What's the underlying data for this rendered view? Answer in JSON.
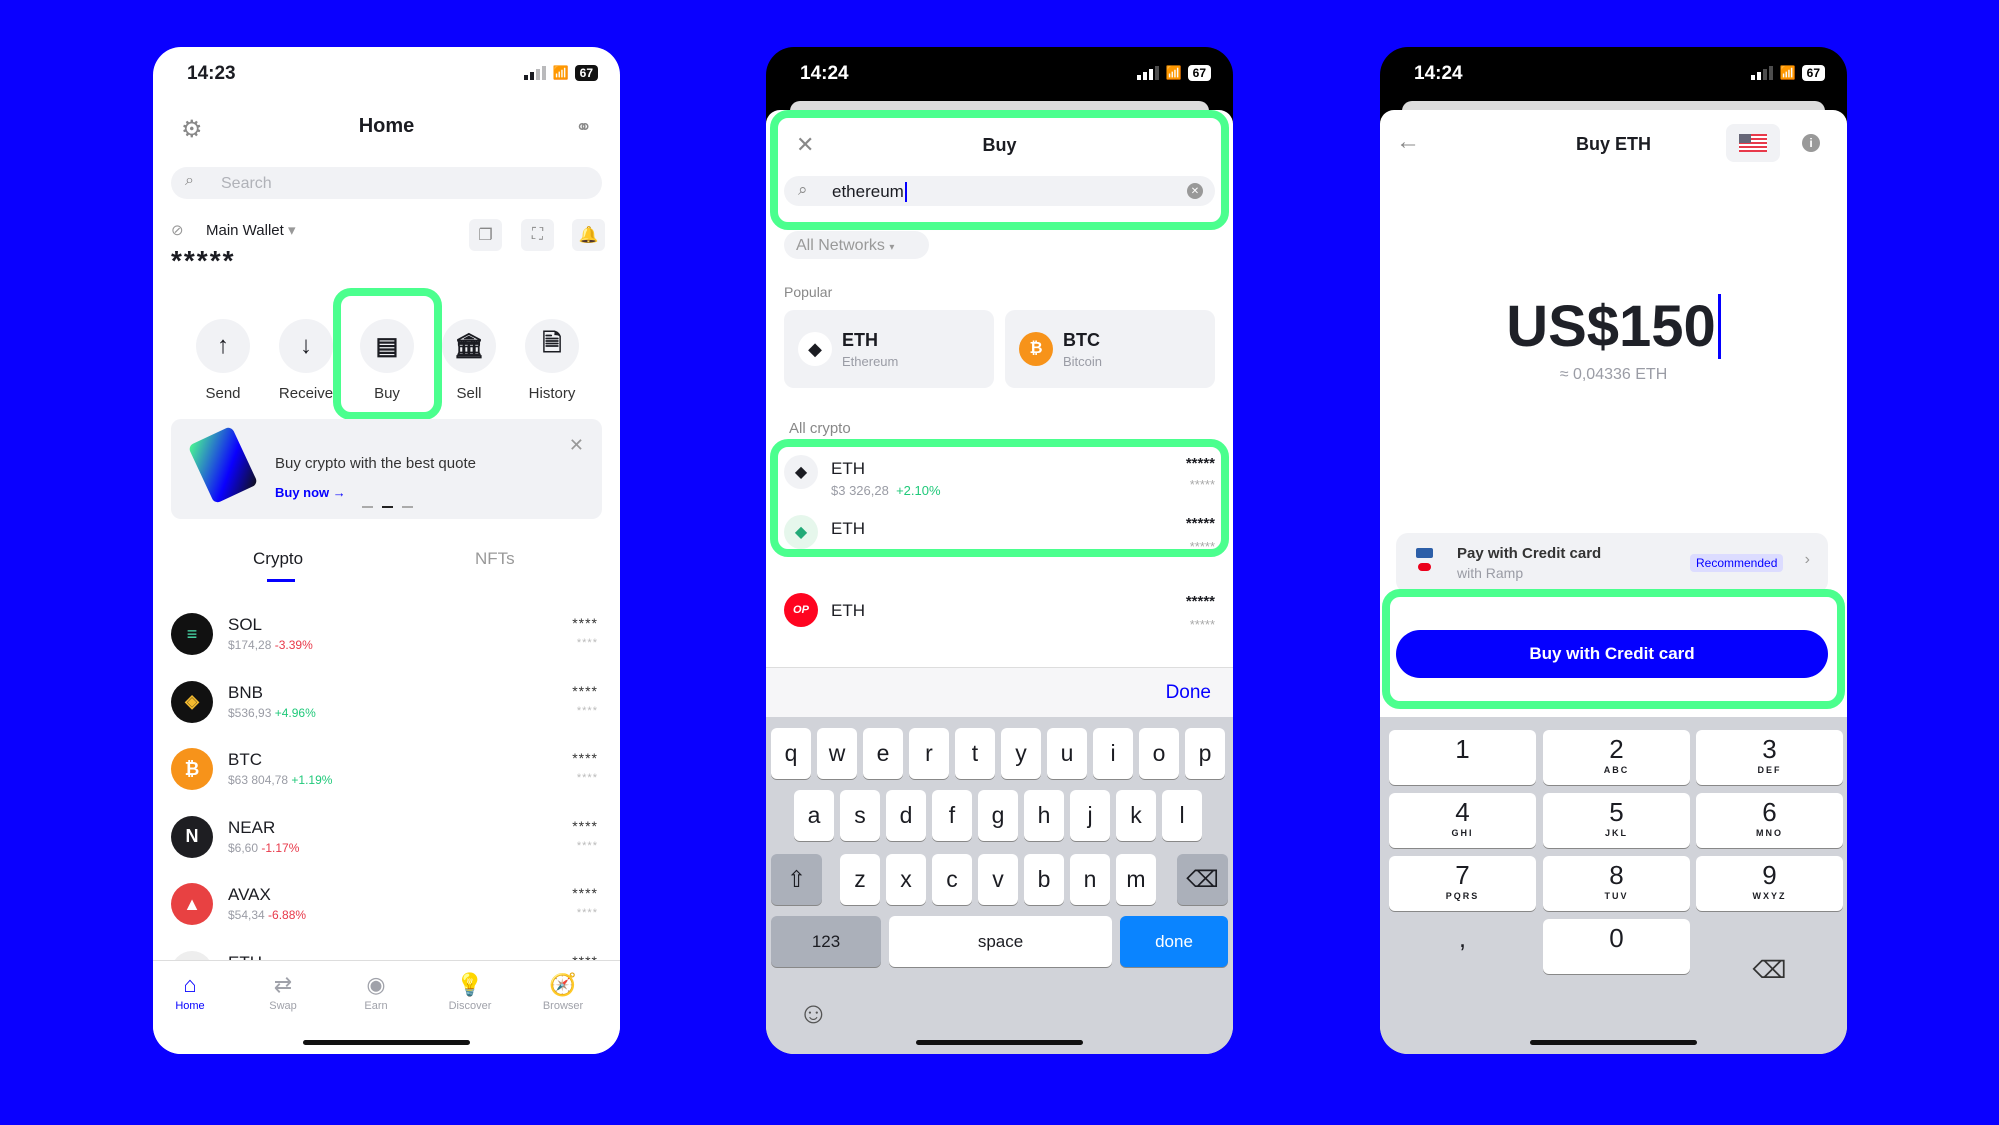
{
  "accent": "#0500ff",
  "highlight": "#4bff8e",
  "screen1": {
    "status": {
      "time": "14:23",
      "battery": "67"
    },
    "title": "Home",
    "search_placeholder": "Search",
    "wallet": {
      "name": "Main Wallet",
      "balance": "*****"
    },
    "actions": [
      {
        "label": "Send",
        "icon": "arrow-up"
      },
      {
        "label": "Receive",
        "icon": "arrow-down"
      },
      {
        "label": "Buy",
        "icon": "card"
      },
      {
        "label": "Sell",
        "icon": "bank"
      },
      {
        "label": "History",
        "icon": "history"
      }
    ],
    "banner": {
      "text": "Buy crypto with the best quote",
      "link": "Buy now"
    },
    "tabs": [
      "Crypto",
      "NFTs"
    ],
    "assets": [
      {
        "symbol": "SOL",
        "price": "$174,28",
        "change": "-3.39%",
        "balance": "****",
        "value": "****",
        "color": "#111"
      },
      {
        "symbol": "BNB",
        "price": "$536,93",
        "change": "+4.96%",
        "balance": "****",
        "value": "****",
        "color": "#111"
      },
      {
        "symbol": "BTC",
        "price": "$63 804,78",
        "change": "+1.19%",
        "balance": "****",
        "value": "****",
        "color": "#f7931a"
      },
      {
        "symbol": "NEAR",
        "price": "$6,60",
        "change": "-1.17%",
        "balance": "****",
        "value": "****",
        "color": "#1e1e22"
      },
      {
        "symbol": "AVAX",
        "price": "$54,34",
        "change": "-6.88%",
        "balance": "****",
        "value": "****",
        "color": "#e84142"
      },
      {
        "symbol": "ETH",
        "price": "",
        "change": "",
        "balance": "****",
        "value": "",
        "color": "#eee"
      }
    ],
    "nav": [
      "Home",
      "Swap",
      "Earn",
      "Discover",
      "Browser"
    ]
  },
  "screen2": {
    "status": {
      "time": "14:24",
      "battery": "67"
    },
    "title": "Buy",
    "search_value": "ethereum",
    "network_filter": "All Networks",
    "popular_label": "Popular",
    "popular": [
      {
        "symbol": "ETH",
        "name": "Ethereum"
      },
      {
        "symbol": "BTC",
        "name": "Bitcoin"
      }
    ],
    "all_label": "All crypto",
    "results": [
      {
        "symbol": "ETH",
        "price": "$3 326,28",
        "change": "+2.10%",
        "balance": "*****",
        "value": "*****"
      },
      {
        "symbol": "ETH",
        "price": "",
        "change": "",
        "balance": "*****",
        "value": "*****"
      },
      {
        "symbol": "ETH",
        "price": "",
        "change": "",
        "balance": "*****",
        "value": "*****",
        "badge": "OP"
      }
    ],
    "done_label": "Done",
    "keyboard": {
      "row1": [
        "q",
        "w",
        "e",
        "r",
        "t",
        "y",
        "u",
        "i",
        "o",
        "p"
      ],
      "row2": [
        "a",
        "s",
        "d",
        "f",
        "g",
        "h",
        "j",
        "k",
        "l"
      ],
      "row3": [
        "z",
        "x",
        "c",
        "v",
        "b",
        "n",
        "m"
      ],
      "numbers": "123",
      "space": "space",
      "done": "done"
    }
  },
  "screen3": {
    "status": {
      "time": "14:24",
      "battery": "67"
    },
    "title": "Buy ETH",
    "amount": "US$150",
    "converted": "≈ 0,04336 ETH",
    "payment": {
      "title": "Pay with Credit card",
      "subtitle": "with Ramp",
      "badge": "Recommended"
    },
    "button": "Buy with Credit card",
    "keypad": [
      {
        "n": "1",
        "l": ""
      },
      {
        "n": "2",
        "l": "ABC"
      },
      {
        "n": "3",
        "l": "DEF"
      },
      {
        "n": "4",
        "l": "GHI"
      },
      {
        "n": "5",
        "l": "JKL"
      },
      {
        "n": "6",
        "l": "MNO"
      },
      {
        "n": "7",
        "l": "PQRS"
      },
      {
        "n": "8",
        "l": "TUV"
      },
      {
        "n": "9",
        "l": "WXYZ"
      },
      {
        "n": ",",
        "l": ""
      },
      {
        "n": "0",
        "l": ""
      }
    ]
  }
}
